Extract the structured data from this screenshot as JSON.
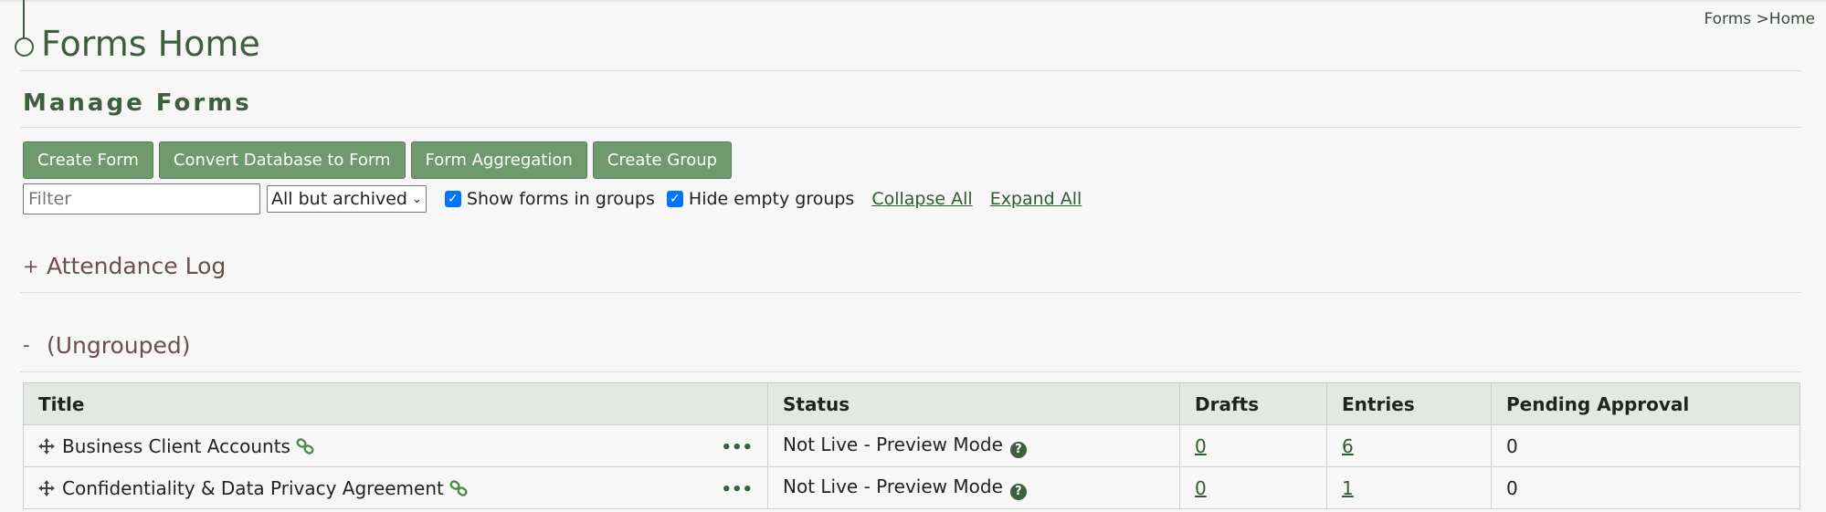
{
  "breadcrumb": {
    "parent": "Forms",
    "separator": ">",
    "current": "Home"
  },
  "page_title": "Forms Home",
  "section_title": "Manage Forms",
  "buttons": {
    "create_form": "Create Form",
    "convert_db": "Convert Database to Form",
    "aggregation": "Form Aggregation",
    "create_group": "Create Group"
  },
  "controls": {
    "filter_placeholder": "Filter",
    "status_select": "All but archived",
    "show_groups_label": "Show forms in groups",
    "hide_empty_label": "Hide empty groups",
    "collapse_all": "Collapse All",
    "expand_all": "Expand All"
  },
  "groups": [
    {
      "toggle": "+",
      "name": "Attendance Log"
    },
    {
      "toggle": "-",
      "name": "(Ungrouped)"
    }
  ],
  "table": {
    "headers": [
      "Title",
      "Status",
      "Drafts",
      "Entries",
      "Pending Approval"
    ],
    "rows": [
      {
        "title": "Business Client Accounts",
        "status": "Not Live - Preview Mode",
        "drafts": "0",
        "entries": "6",
        "pending": "0"
      },
      {
        "title": "Confidentiality & Data Privacy Agreement",
        "status": "Not Live - Preview Mode",
        "drafts": "0",
        "entries": "1",
        "pending": "0"
      }
    ]
  },
  "icons": {
    "row_menu": "•••",
    "help": "?",
    "checkmark": "✓",
    "select_chevron": "⌄"
  },
  "colors": {
    "accent": "#3f5d3f",
    "button": "#6e9a6e",
    "group_title": "#6b4f4f",
    "checkbox": "#0075ff"
  }
}
